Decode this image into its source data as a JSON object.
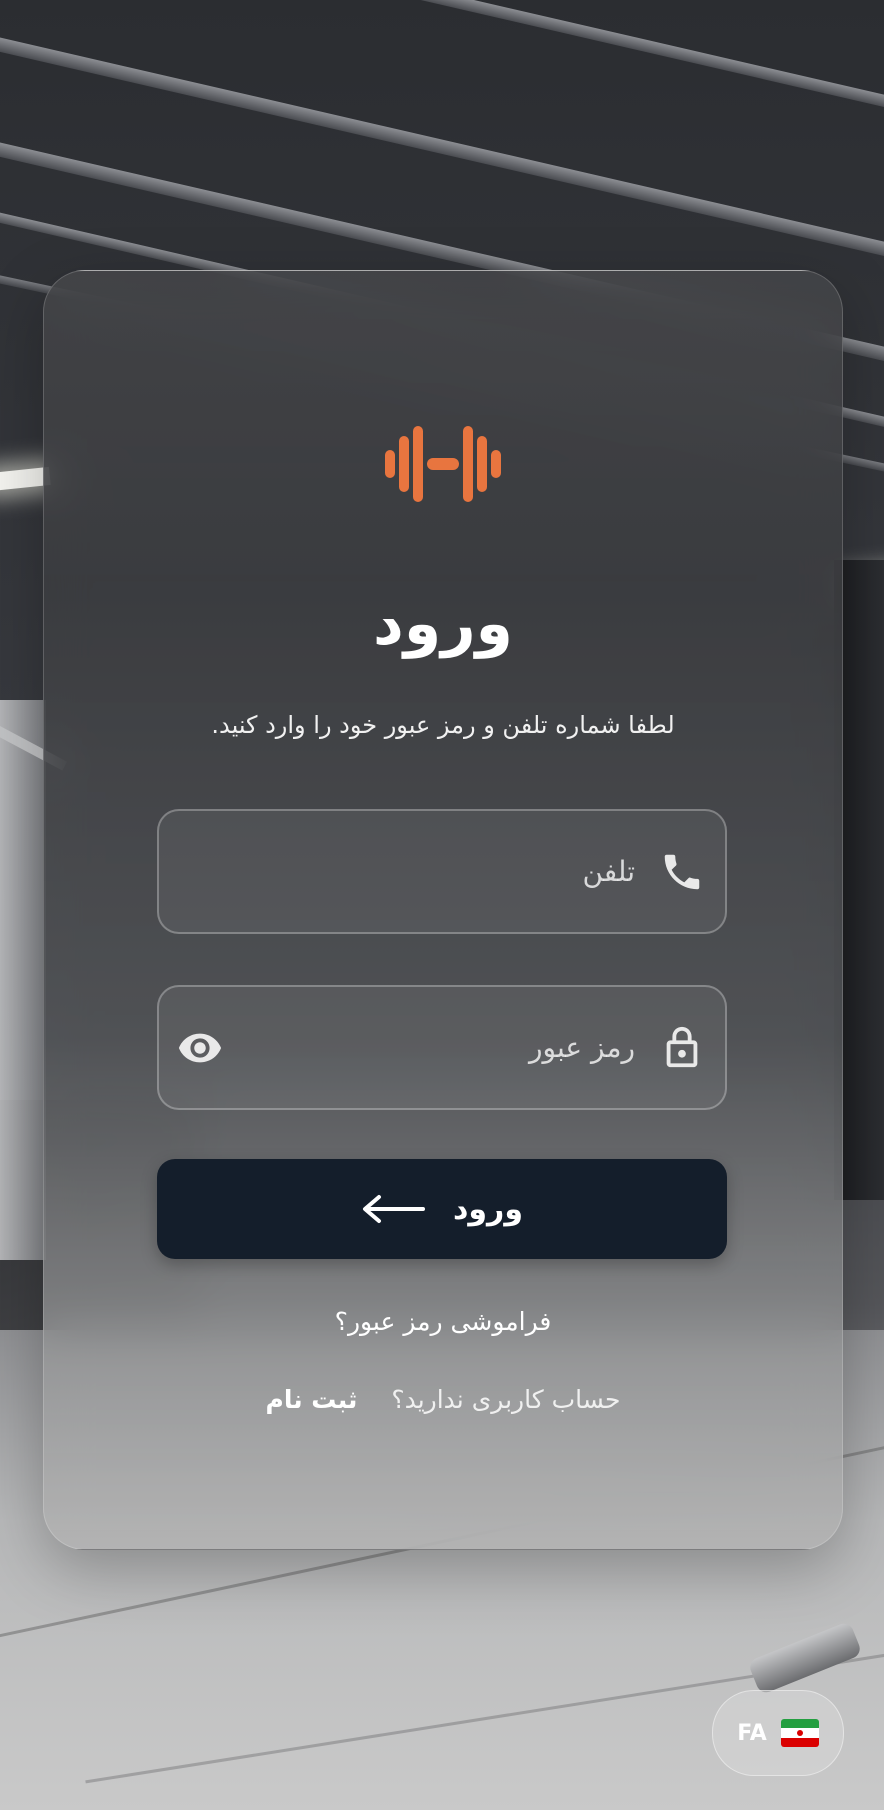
{
  "theme": {
    "accent": "#e8753f",
    "button_bg": "#141e2b",
    "text": "#ffffff"
  },
  "logo": {
    "icon": "dumbbell-icon"
  },
  "login": {
    "title": "ورود",
    "subtitle": "لطفا شماره تلفن و رمز عبور خود را وارد کنید.",
    "phone": {
      "placeholder": "تلفن",
      "value": "",
      "icon": "phone-icon"
    },
    "password": {
      "placeholder": "رمز عبور",
      "value": "",
      "icon": "lock-icon",
      "toggle_icon": "eye-icon"
    },
    "submit_label": "ورود",
    "submit_icon": "arrow-left-icon",
    "forgot_label": "فراموشی رمز عبور؟",
    "no_account_label": "حساب کاربری ندارید؟",
    "signup_label": "ثبت نام"
  },
  "language": {
    "code": "FA",
    "flag": "iran-flag-icon"
  }
}
